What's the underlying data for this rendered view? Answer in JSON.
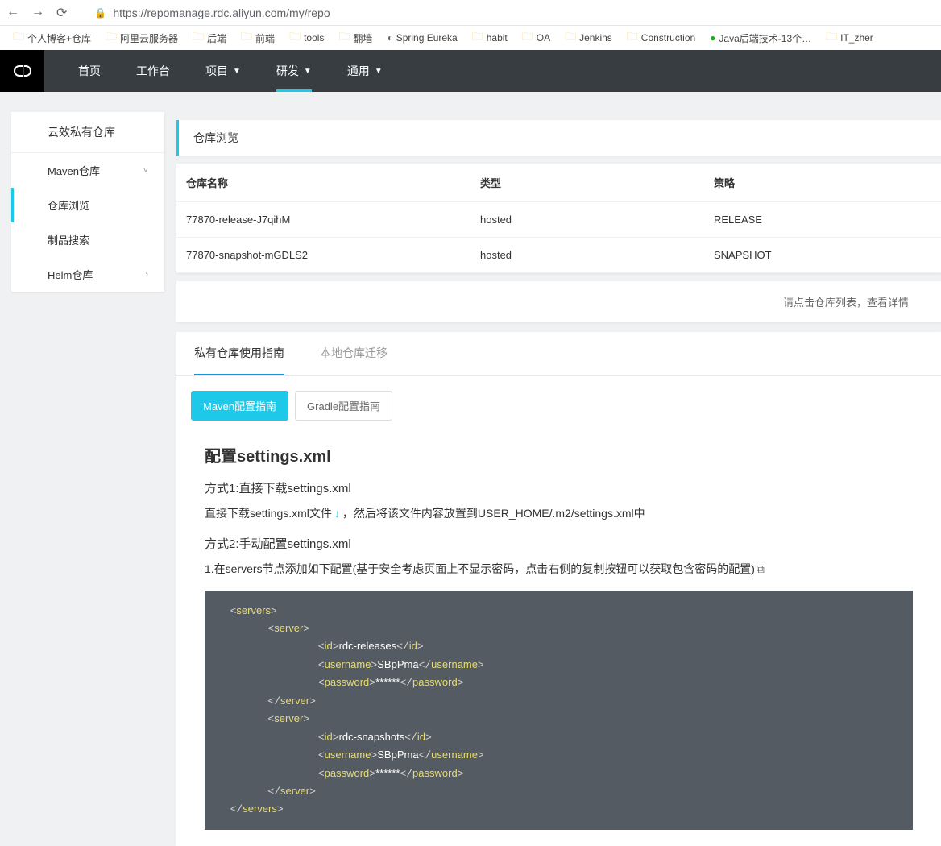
{
  "browser": {
    "url": "https://repomanage.rdc.aliyun.com/my/repo"
  },
  "bookmarks": [
    {
      "t": "folder",
      "label": "个人博客+仓库"
    },
    {
      "t": "folder",
      "label": "阿里云服务器"
    },
    {
      "t": "folder",
      "label": "后端"
    },
    {
      "t": "folder",
      "label": "前端"
    },
    {
      "t": "folder",
      "label": "tools"
    },
    {
      "t": "folder",
      "label": "翻墙"
    },
    {
      "t": "globe",
      "label": "Spring Eureka"
    },
    {
      "t": "folder",
      "label": "habit"
    },
    {
      "t": "folder",
      "label": "OA"
    },
    {
      "t": "folder",
      "label": "Jenkins"
    },
    {
      "t": "folder",
      "label": "Construction"
    },
    {
      "t": "green",
      "label": "Java后端技术-13个…"
    },
    {
      "t": "folder",
      "label": "IT_zher"
    }
  ],
  "nav": [
    {
      "label": "首页",
      "caret": false,
      "active": false
    },
    {
      "label": "工作台",
      "caret": false,
      "active": false
    },
    {
      "label": "项目",
      "caret": true,
      "active": false
    },
    {
      "label": "研发",
      "caret": true,
      "active": true
    },
    {
      "label": "通用",
      "caret": true,
      "active": false
    }
  ],
  "sidebar": {
    "title": "云效私有仓库",
    "items": [
      {
        "label": "Maven仓库",
        "caret": "v",
        "active": false
      },
      {
        "label": "仓库浏览",
        "caret": "",
        "active": true
      },
      {
        "label": "制品搜索",
        "caret": "",
        "active": false
      },
      {
        "label": "Helm仓库",
        "caret": ">",
        "active": false
      }
    ]
  },
  "page": {
    "title": "仓库浏览",
    "hint": "请点击仓库列表，查看详情"
  },
  "table": {
    "headers": {
      "name": "仓库名称",
      "type": "类型",
      "policy": "策略"
    },
    "rows": [
      {
        "name": "77870-release-J7qihM",
        "type": "hosted",
        "policy": "RELEASE"
      },
      {
        "name": "77870-snapshot-mGDLS2",
        "type": "hosted",
        "policy": "SNAPSHOT"
      }
    ]
  },
  "tabs": [
    {
      "label": "私有仓库使用指南",
      "active": true
    },
    {
      "label": "本地仓库迁移",
      "active": false
    }
  ],
  "subtabs": [
    {
      "label": "Maven配置指南",
      "active": true
    },
    {
      "label": "Gradle配置指南",
      "active": false
    }
  ],
  "guide": {
    "h2": "配置settings.xml",
    "m1_title": "方式1:直接下载settings.xml",
    "m1_text1": "直接下载settings.xml文件",
    "m1_text2": "，然后将该文件内容放置到USER_HOME/.m2/settings.xml中",
    "m2_title": "方式2:手动配置settings.xml",
    "m2_text": "1.在servers节点添加如下配置(基于安全考虑页面上不显示密码，点击右侧的复制按钮可以获取包含密码的配置)"
  },
  "xml": {
    "servers_open": "servers",
    "servers_close": "servers",
    "server_open": "server",
    "server_close": "server",
    "id_open": "id",
    "id_close": "id",
    "un_open": "username",
    "un_close": "username",
    "pw_open": "password",
    "pw_close": "password",
    "id1": "rdc-releases",
    "id2": "rdc-snapshots",
    "un": "SBpPma",
    "pw": "******"
  }
}
